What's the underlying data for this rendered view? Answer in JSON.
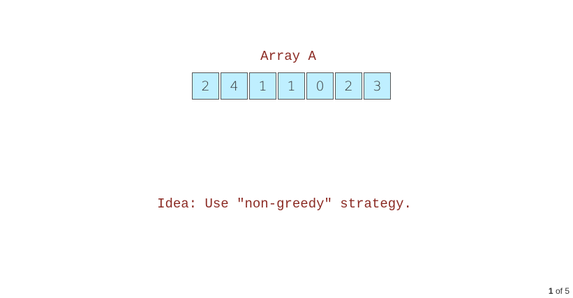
{
  "array": {
    "title": "Array A",
    "cells": [
      "2",
      "4",
      "1",
      "1",
      "0",
      "2",
      "3"
    ]
  },
  "idea_text": "Idea: Use \"non-greedy\" strategy.",
  "pager": {
    "current": "1",
    "separator": "of",
    "total": "5"
  },
  "colors": {
    "text_accent": "#8b2a23",
    "cell_fill": "#bfefff",
    "cell_border": "#555555"
  }
}
